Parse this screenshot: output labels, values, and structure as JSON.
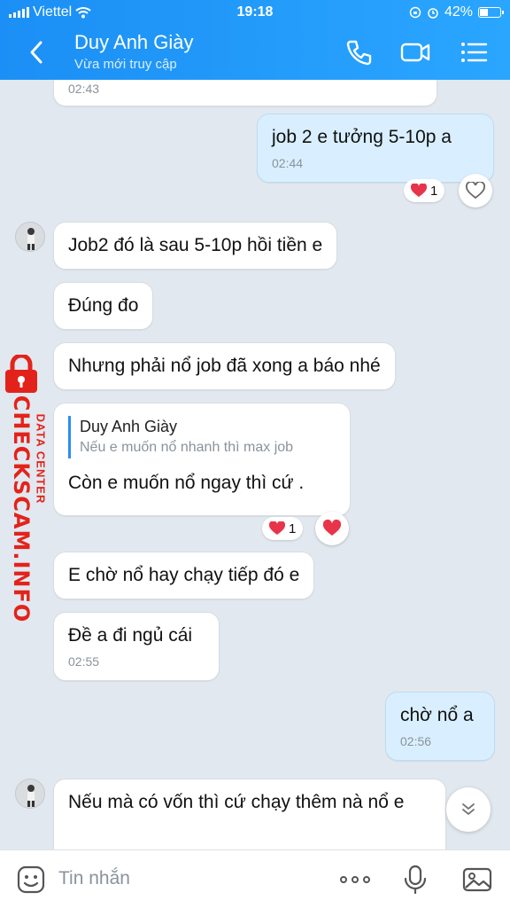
{
  "status": {
    "carrier": "Viettel",
    "time": "19:18",
    "battery": "42%",
    "battery_level": 0.42
  },
  "header": {
    "title": "Duy Anh Giày",
    "subtitle": "Vừa mới truy cập"
  },
  "messages": [
    {
      "text": "",
      "time": "02:43"
    },
    {
      "text": "job 2 e tưởng 5-10p a",
      "time": "02:44",
      "reaction_count": "1"
    },
    {
      "text": "Job2 đó là sau 5-10p hồi tiền e"
    },
    {
      "text": "Đúng đo"
    },
    {
      "text": "Nhưng phải nổ job đã xong a báo nhé"
    },
    {
      "quote_name": "Duy Anh Giày",
      "quote_text": "Nếu e muốn nổ nhanh thì max job",
      "text": "Còn e muốn nổ ngay thì cứ .",
      "reaction_count": "1"
    },
    {
      "text": "E chờ nổ hay chạy tiếp đó e"
    },
    {
      "text": "Đề a đi ngủ cái",
      "time": "02:55"
    },
    {
      "text": "chờ nổ a",
      "time": "02:56"
    },
    {
      "text": "Nếu mà có vốn thì cứ chạy thêm nà nổ e"
    }
  ],
  "watermark": {
    "brand": "CHECKSCAM.INFO",
    "tag": "DATA CENTER"
  },
  "composer": {
    "placeholder": "Tin nhắn"
  },
  "colors": {
    "header": "#1b8ff5",
    "my_bubble": "#d9efff",
    "background": "#e2e8ef",
    "heart": "#e8344a",
    "watermark": "#e3231b"
  }
}
